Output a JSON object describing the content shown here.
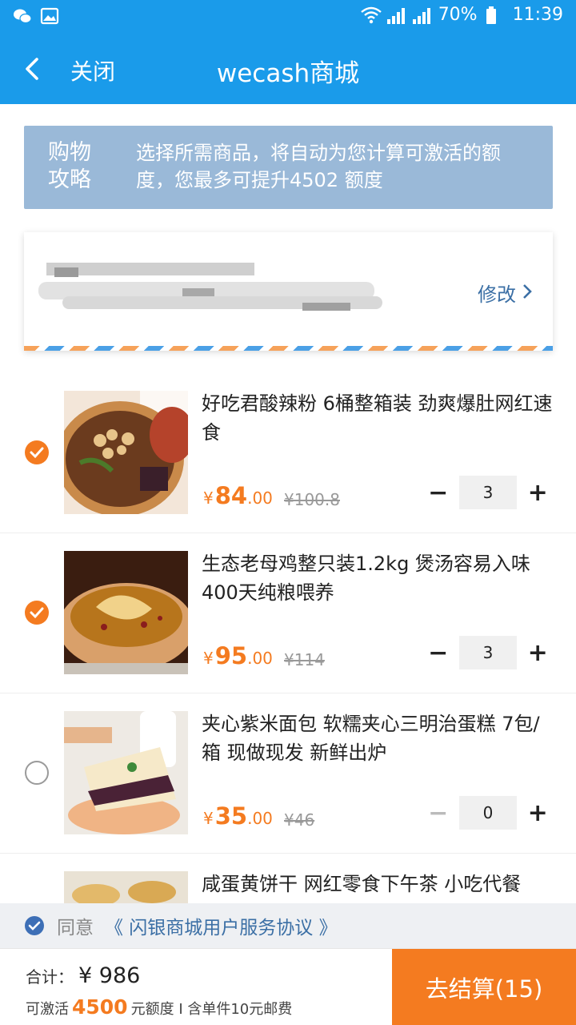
{
  "status_bar": {
    "battery": "70%",
    "time": "11:39",
    "network": "4G"
  },
  "nav": {
    "close": "关闭",
    "title": "wecash商城"
  },
  "guide": {
    "title": "购物攻略",
    "text": "选择所需商品，将自动为您计算可激活的额度，您最多可提升4502 额度"
  },
  "address": {
    "edit": "修改"
  },
  "products": [
    {
      "name": "好吃君酸辣粉 6桶整箱装 劲爽爆肚网红速食",
      "currency": "¥",
      "price_int": "84",
      "price_dec": ".00",
      "orig": "¥100.8",
      "qty": "3",
      "selected": true
    },
    {
      "name": "生态老母鸡整只装1.2kg 煲汤容易入味400天纯粮喂养",
      "currency": "¥",
      "price_int": "95",
      "price_dec": ".00",
      "orig": "¥114",
      "qty": "3",
      "selected": true
    },
    {
      "name": "夹心紫米面包 软糯夹心三明治蛋糕 7包/箱 现做现发 新鲜出炉",
      "currency": "¥",
      "price_int": "35",
      "price_dec": ".00",
      "orig": "¥46",
      "qty": "0",
      "selected": false
    },
    {
      "name": "咸蛋黄饼干 网红零食下午茶 小吃代餐"
    }
  ],
  "stepper": {
    "minus": "−",
    "plus": "+"
  },
  "agreement": {
    "label": "同意",
    "link": "《 闪银商城用户服务协议 》"
  },
  "bottom": {
    "total_label": "合计：",
    "total_amount": "¥ 986",
    "activate_prefix": "可激活",
    "activate_amount": "4500",
    "activate_suffix": "元额度 I 含单件10元邮费",
    "checkout": "去结算(15)"
  },
  "colors": {
    "primary": "#1a9bea",
    "accent": "#f47b20",
    "guide_bg": "#9ab9d8",
    "link": "#3b6fa5"
  }
}
